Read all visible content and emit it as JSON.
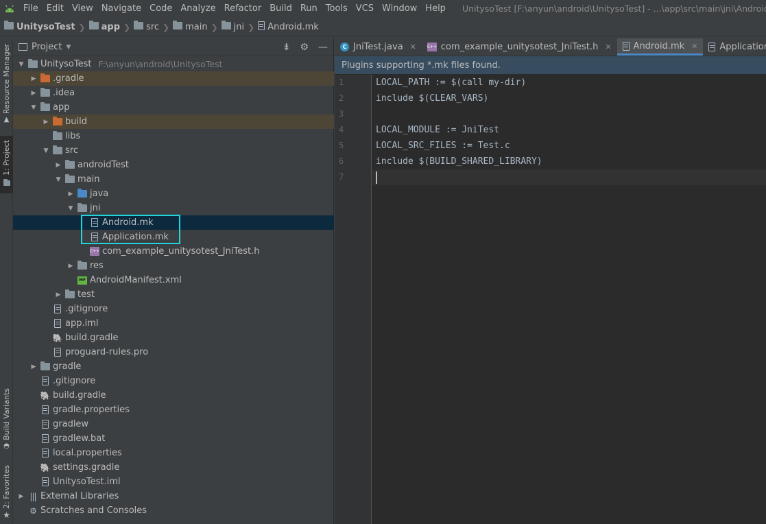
{
  "menu": {
    "items": [
      "File",
      "Edit",
      "View",
      "Navigate",
      "Code",
      "Analyze",
      "Refactor",
      "Build",
      "Run",
      "Tools",
      "VCS",
      "Window",
      "Help"
    ],
    "window_title": "UnitysoTest [F:\\anyun\\android\\UnitysoTest] - ...\\app\\src\\main\\jni\\Android.mk [app"
  },
  "breadcrumb": [
    "UnitysoTest",
    "app",
    "src",
    "main",
    "jni",
    "Android.mk"
  ],
  "left_strip": {
    "resource_manager": "Resource Manager",
    "project": "1: Project",
    "build_variants": "Build Variants",
    "favorites": "2: Favorites"
  },
  "project_panel": {
    "title": "Project",
    "tree": [
      {
        "label": "UnitysoTest",
        "path": "F:\\anyun\\android\\UnitysoTest",
        "depth": 0,
        "arrow": "down",
        "icon": "module-folder-icon"
      },
      {
        "label": ".gradle",
        "depth": 1,
        "arrow": "right",
        "icon": "folder-orange-icon",
        "excluded": true
      },
      {
        "label": ".idea",
        "depth": 1,
        "arrow": "right",
        "icon": "folder-icon"
      },
      {
        "label": "app",
        "depth": 1,
        "arrow": "down",
        "icon": "module-folder-icon"
      },
      {
        "label": "build",
        "depth": 2,
        "arrow": "right",
        "icon": "folder-orange-icon",
        "excluded": true
      },
      {
        "label": "libs",
        "depth": 2,
        "arrow": "",
        "icon": "folder-icon"
      },
      {
        "label": "src",
        "depth": 2,
        "arrow": "down",
        "icon": "folder-icon"
      },
      {
        "label": "androidTest",
        "depth": 3,
        "arrow": "right",
        "icon": "folder-icon"
      },
      {
        "label": "main",
        "depth": 3,
        "arrow": "down",
        "icon": "folder-icon"
      },
      {
        "label": "java",
        "depth": 4,
        "arrow": "right",
        "icon": "folder-blue-icon"
      },
      {
        "label": "jni",
        "depth": 4,
        "arrow": "down",
        "icon": "folder-icon"
      },
      {
        "label": "Android.mk",
        "depth": 5,
        "arrow": "",
        "icon": "file-icon",
        "selected": true
      },
      {
        "label": "Application.mk",
        "depth": 5,
        "arrow": "",
        "icon": "file-icon"
      },
      {
        "label": "com_example_unitysotest_JniTest.h",
        "depth": 5,
        "arrow": "",
        "icon": "header-file-icon"
      },
      {
        "label": "res",
        "depth": 4,
        "arrow": "right",
        "icon": "folder-icon"
      },
      {
        "label": "AndroidManifest.xml",
        "depth": 4,
        "arrow": "",
        "icon": "manifest-icon"
      },
      {
        "label": "test",
        "depth": 3,
        "arrow": "right",
        "icon": "folder-icon"
      },
      {
        "label": ".gitignore",
        "depth": 2,
        "arrow": "",
        "icon": "file-icon"
      },
      {
        "label": "app.iml",
        "depth": 2,
        "arrow": "",
        "icon": "file-icon"
      },
      {
        "label": "build.gradle",
        "depth": 2,
        "arrow": "",
        "icon": "gradle-icon"
      },
      {
        "label": "proguard-rules.pro",
        "depth": 2,
        "arrow": "",
        "icon": "file-icon"
      },
      {
        "label": "gradle",
        "depth": 1,
        "arrow": "right",
        "icon": "folder-icon"
      },
      {
        "label": ".gitignore",
        "depth": 1,
        "arrow": "",
        "icon": "file-icon"
      },
      {
        "label": "build.gradle",
        "depth": 1,
        "arrow": "",
        "icon": "gradle-icon"
      },
      {
        "label": "gradle.properties",
        "depth": 1,
        "arrow": "",
        "icon": "file-icon"
      },
      {
        "label": "gradlew",
        "depth": 1,
        "arrow": "",
        "icon": "file-icon"
      },
      {
        "label": "gradlew.bat",
        "depth": 1,
        "arrow": "",
        "icon": "file-icon"
      },
      {
        "label": "local.properties",
        "depth": 1,
        "arrow": "",
        "icon": "file-icon"
      },
      {
        "label": "settings.gradle",
        "depth": 1,
        "arrow": "",
        "icon": "gradle-icon"
      },
      {
        "label": "UnitysoTest.iml",
        "depth": 1,
        "arrow": "",
        "icon": "file-icon"
      },
      {
        "label": "External Libraries",
        "depth": 0,
        "arrow": "right",
        "icon": "libraries-icon"
      },
      {
        "label": "Scratches and Consoles",
        "depth": 0,
        "arrow": "",
        "icon": "scratches-icon"
      }
    ]
  },
  "editor": {
    "tabs": [
      {
        "label": "JniTest.java",
        "icon": "java-class-icon",
        "active": false
      },
      {
        "label": "com_example_unitysotest_JniTest.h",
        "icon": "header-file-icon",
        "active": false
      },
      {
        "label": "Android.mk",
        "icon": "file-icon",
        "active": true
      },
      {
        "label": "Application.mk",
        "icon": "file-icon",
        "active": false
      }
    ],
    "banner": "Plugins supporting *.mk files found.",
    "lines": [
      "LOCAL_PATH := $(call my-dir)",
      "include $(CLEAR_VARS)",
      "",
      "LOCAL_MODULE := JniTest",
      "LOCAL_SRC_FILES := Test.c",
      "include $(BUILD_SHARED_LIBRARY)",
      ""
    ]
  },
  "colors": {
    "highlight_box": "#1fd6dc",
    "selection": "#0d293e",
    "accent": "#4a88c7"
  }
}
